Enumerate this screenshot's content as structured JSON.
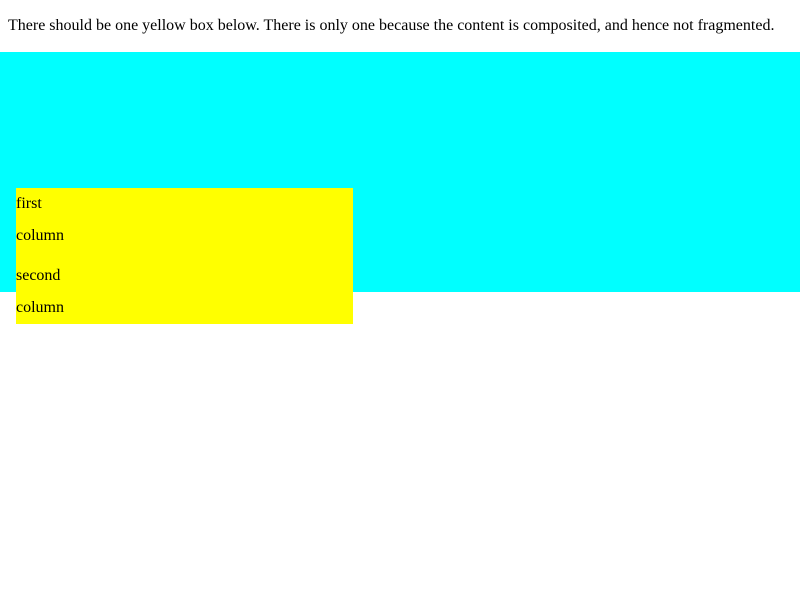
{
  "description": "There should be one yellow box below. There is only one because the content is composited, and hence not fragmented.",
  "colors": {
    "container": "#00ffff",
    "box": "#ffff00"
  },
  "box": {
    "lines": [
      "first",
      "column",
      "second",
      "column"
    ]
  }
}
